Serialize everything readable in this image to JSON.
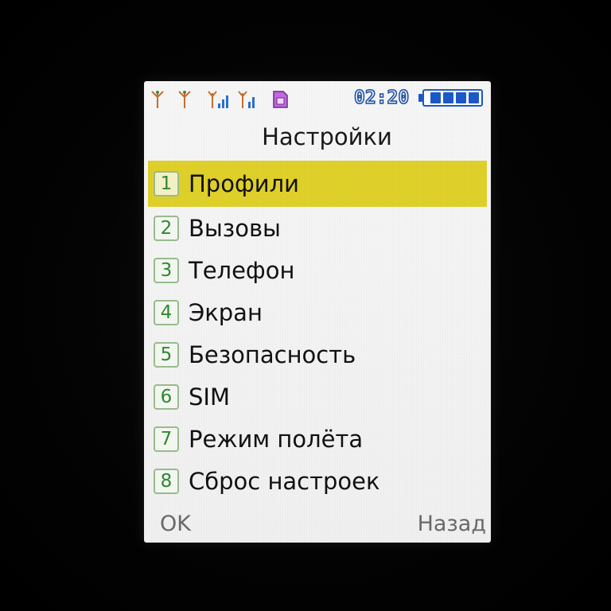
{
  "status_bar": {
    "time": "02:20",
    "battery_level": 1.0,
    "icons": [
      "antenna-icon",
      "antenna-icon",
      "signal-strength-icon",
      "signal-strength-icon",
      "sim-card-icon"
    ]
  },
  "screen": {
    "title": "Настройки"
  },
  "menu": {
    "selected_index": 0,
    "items": [
      {
        "number": "1",
        "label": "Профили"
      },
      {
        "number": "2",
        "label": "Вызовы"
      },
      {
        "number": "3",
        "label": "Телефон"
      },
      {
        "number": "4",
        "label": "Экран"
      },
      {
        "number": "5",
        "label": "Безопасность"
      },
      {
        "number": "6",
        "label": "SIM"
      },
      {
        "number": "7",
        "label": "Режим полёта"
      },
      {
        "number": "8",
        "label": "Сброс настроек"
      }
    ]
  },
  "softkeys": {
    "left": "OK",
    "right": "Назад"
  },
  "colors": {
    "highlight": "#e0d12a",
    "number_text": "#2f8a2f",
    "battery": "#1c59c9",
    "clock": "#1d4e9e"
  }
}
